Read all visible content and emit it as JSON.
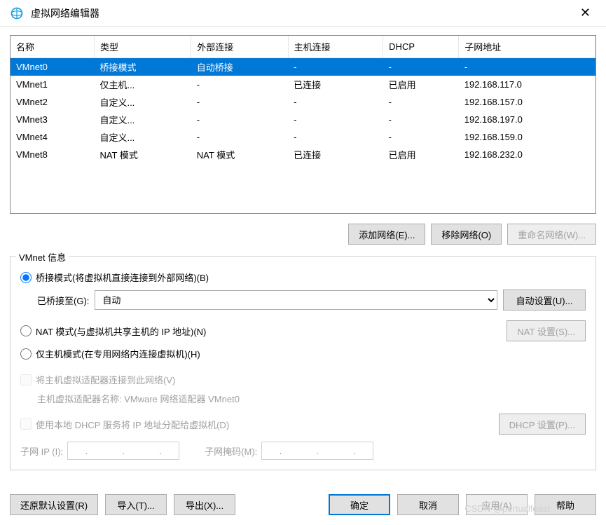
{
  "window": {
    "title": "虚拟网络编辑器"
  },
  "table": {
    "headers": [
      "名称",
      "类型",
      "外部连接",
      "主机连接",
      "DHCP",
      "子网地址"
    ],
    "rows": [
      {
        "name": "VMnet0",
        "type": "桥接模式",
        "ext": "自动桥接",
        "host": "-",
        "dhcp": "-",
        "subnet": "-",
        "selected": true
      },
      {
        "name": "VMnet1",
        "type": "仅主机...",
        "ext": "-",
        "host": "已连接",
        "dhcp": "已启用",
        "subnet": "192.168.117.0"
      },
      {
        "name": "VMnet2",
        "type": "自定义...",
        "ext": "-",
        "host": "-",
        "dhcp": "-",
        "subnet": "192.168.157.0"
      },
      {
        "name": "VMnet3",
        "type": "自定义...",
        "ext": "-",
        "host": "-",
        "dhcp": "-",
        "subnet": "192.168.197.0"
      },
      {
        "name": "VMnet4",
        "type": "自定义...",
        "ext": "-",
        "host": "-",
        "dhcp": "-",
        "subnet": "192.168.159.0"
      },
      {
        "name": "VMnet8",
        "type": "NAT 模式",
        "ext": "NAT 模式",
        "host": "已连接",
        "dhcp": "已启用",
        "subnet": "192.168.232.0"
      }
    ]
  },
  "buttons": {
    "add_network": "添加网络(E)...",
    "remove_network": "移除网络(O)",
    "rename_network": "重命名网络(W)..."
  },
  "vmnet_info": {
    "legend": "VMnet 信息",
    "bridge_radio": "桥接模式(将虚拟机直接连接到外部网络)(B)",
    "bridged_to_label": "已桥接至(G):",
    "bridged_to_value": "自动",
    "auto_settings": "自动设置(U)...",
    "nat_radio": "NAT 模式(与虚拟机共享主机的 IP 地址)(N)",
    "nat_settings": "NAT 设置(S)...",
    "hostonly_radio": "仅主机模式(在专用网络内连接虚拟机)(H)",
    "connect_adapter": "将主机虚拟适配器连接到此网络(V)",
    "adapter_name": "主机虚拟适配器名称: VMware 网络适配器 VMnet0",
    "use_dhcp": "使用本地 DHCP 服务将 IP 地址分配给虚拟机(D)",
    "dhcp_settings": "DHCP 设置(P)...",
    "subnet_ip_label": "子网 IP (I):",
    "subnet_mask_label": "子网掩码(M):"
  },
  "footer": {
    "restore": "还原默认设置(R)",
    "import": "导入(T)...",
    "export": "导出(X)...",
    "ok": "确定",
    "cancel": "取消",
    "apply": "应用(A)",
    "help": "帮助"
  },
  "watermark": "CSDN @pertualfeast"
}
